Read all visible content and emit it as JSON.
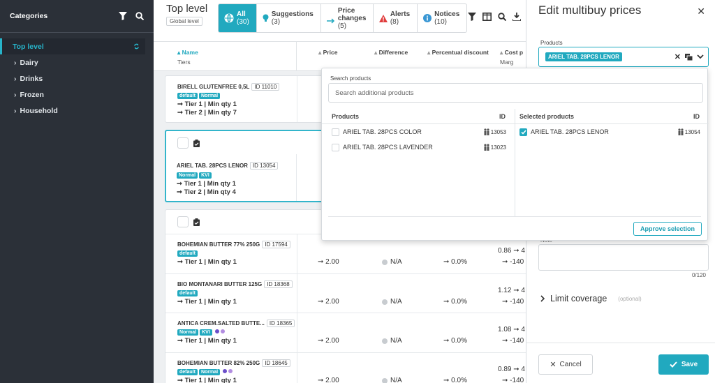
{
  "sidebar": {
    "title": "Categories",
    "items": [
      {
        "label": "Top level",
        "active": true
      },
      {
        "label": "Dairy"
      },
      {
        "label": "Drinks"
      },
      {
        "label": "Frozen"
      },
      {
        "label": "Household"
      }
    ]
  },
  "header": {
    "level_title": "Top level",
    "level_sub": "Global level",
    "tabs": [
      {
        "label": "All",
        "count": "(30)",
        "icon": "globe-icon",
        "selected": true
      },
      {
        "label": "Suggestions",
        "count": "(3)",
        "icon": "lightbulb-icon"
      },
      {
        "label": "Price changes",
        "count": "(5)",
        "icon": "arrow-right-icon"
      },
      {
        "label": "Alerts",
        "count": "(8)",
        "icon": "warning-icon"
      },
      {
        "label": "Notices",
        "count": "(10)",
        "icon": "info-icon"
      }
    ]
  },
  "columns": {
    "name": "Name",
    "name_sub": "Tiers",
    "price": "Price",
    "difference": "Difference",
    "pct_discount": "Percentual discount",
    "cost_price": "Cost p",
    "cost_sub": "Marg"
  },
  "products": [
    {
      "name": "BIRELL GLUTENFREE 0,5L",
      "id": "ID 11010",
      "badges": [
        "default",
        "Normal"
      ],
      "tiers": [
        "Tier 1 | Min qty 1",
        "Tier 2 | Min qty 7"
      ]
    },
    {
      "name": "ARIEL TAB. 28PCS LENOR",
      "id": "ID 13054",
      "badges": [
        "Normal",
        "KVI"
      ],
      "tiers": [
        "Tier 1 | Min qty 1",
        "Tier 2 | Min qty 4"
      ]
    },
    {
      "name": "BOHEMIAN BUTTER 77% 250G",
      "id": "ID 17594",
      "badges": [
        "default"
      ],
      "tiers": [
        "Tier 1 | Min qty 1"
      ],
      "price": "2.00",
      "difference": "N/A",
      "pct": "0.0%",
      "cost": "0.86",
      "margin": "-140"
    },
    {
      "name": "BIO MONTANARI BUTTER 125G",
      "id": "ID 18368",
      "badges": [
        "default"
      ],
      "tiers": [
        "Tier 1 | Min qty 1"
      ],
      "price": "2.00",
      "difference": "N/A",
      "pct": "0.0%",
      "cost": "1.12",
      "margin": "-140"
    },
    {
      "name": "ANTICA CREM.SALTED BUTTE...",
      "id": "ID 18365",
      "badges": [
        "Normal",
        "KVI"
      ],
      "tiers": [
        "Tier 1 | Min qty 1"
      ],
      "price": "2.00",
      "difference": "N/A",
      "pct": "0.0%",
      "cost": "1.08",
      "margin": "-140"
    },
    {
      "name": "BOHEMIAN BUTTER 82% 250G",
      "id": "ID 18645",
      "badges": [
        "default",
        "Normal"
      ],
      "tiers": [
        "Tier 1 | Min qty 1"
      ],
      "price": "2.00",
      "difference": "N/A",
      "pct": "0.0%",
      "cost": "0.89",
      "margin": "-140"
    }
  ],
  "dropdown": {
    "search_label": "Search products",
    "search_placeholder": "Search additional products",
    "left_header": "Products",
    "right_header": "Selected products",
    "id_header": "ID",
    "available": [
      {
        "name": "ARIEL TAB. 28PCS COLOR",
        "id": "13053"
      },
      {
        "name": "ARIEL TAB. 28PCS LAVENDER",
        "id": "13023"
      }
    ],
    "selected": [
      {
        "name": "ARIEL TAB. 28PCS LENOR",
        "id": "13054"
      }
    ],
    "approve_label": "Approve selection"
  },
  "panel": {
    "title": "Edit multibuy prices",
    "products_label": "Products",
    "chip": "ARIEL TAB. 28PCS LENOR",
    "note_label": "Note",
    "note_count": "0/120",
    "limit_label": "Limit coverage",
    "limit_optional": "(optional)",
    "cancel_label": "Cancel",
    "save_label": "Save"
  },
  "colors": {
    "accent": "#21a9bf",
    "sidebar_bg": "#2b3038",
    "alert": "#e03c3c",
    "info": "#3a97d4"
  }
}
